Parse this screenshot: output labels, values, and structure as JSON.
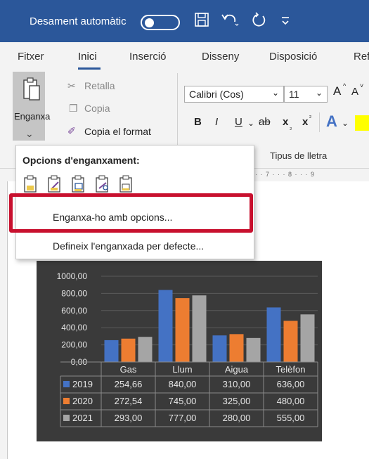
{
  "title_bar": {
    "autosave_label": "Desament automàtic",
    "icons": [
      "save-icon",
      "undo-icon",
      "redo-icon",
      "customize-icon"
    ]
  },
  "tabs": [
    {
      "label": "Fitxer",
      "active": false
    },
    {
      "label": "Inici",
      "active": true
    },
    {
      "label": "Inserció",
      "active": false
    },
    {
      "label": "Disseny",
      "active": false
    },
    {
      "label": "Disposició",
      "active": false
    },
    {
      "label": "Ref",
      "active": false
    }
  ],
  "ribbon": {
    "paste_label": "Enganxa",
    "cut_label": "Retalla",
    "copy_label": "Copia",
    "format_painter_label": "Copia el format",
    "font_name": "Calibri (Cos)",
    "font_size": "11",
    "grow_font": "A",
    "shrink_font": "A",
    "bold": "B",
    "italic": "I",
    "underline": "U",
    "strikethrough": "ab",
    "subscript": "x",
    "superscript": "x",
    "text_effects": "A",
    "font_group_label": "Tipus de lletra"
  },
  "ruler_text": "6 · · · 7 · · · 8 · · · 9",
  "paste_menu": {
    "title": "Opcions d'enganxament:",
    "options": [
      "paste-keep-source-icon",
      "paste-use-destination-theme-icon",
      "paste-embed-workbook-icon",
      "paste-link-icon",
      "paste-picture-icon"
    ],
    "items": [
      "Enganxa-ho amb opcions...",
      "Defineix l'enganxada per defecte..."
    ]
  },
  "chart_data": {
    "type": "bar",
    "categories": [
      "Gas",
      "Llum",
      "Aigua",
      "Telèfon"
    ],
    "series": [
      {
        "name": "2019",
        "color": "#4472c4",
        "values": [
          254.66,
          840.0,
          310.0,
          636.0
        ],
        "labels": [
          "254,66",
          "840,00",
          "310,00",
          "636,00"
        ]
      },
      {
        "name": "2020",
        "color": "#ed7d31",
        "values": [
          272.54,
          745.0,
          325.0,
          480.0
        ],
        "labels": [
          "272,54",
          "745,00",
          "325,00",
          "480,00"
        ]
      },
      {
        "name": "2021",
        "color": "#a5a5a5",
        "values": [
          293.0,
          777.0,
          280.0,
          555.0
        ],
        "labels": [
          "293,00",
          "777,00",
          "280,00",
          "555,00"
        ]
      }
    ],
    "ylim": [
      0,
      1000
    ],
    "yticks": [
      "0,00",
      "200,00",
      "400,00",
      "600,00",
      "800,00",
      "1000,00"
    ],
    "title": "",
    "xlabel": "",
    "ylabel": "",
    "data_table": true,
    "grid": true
  }
}
